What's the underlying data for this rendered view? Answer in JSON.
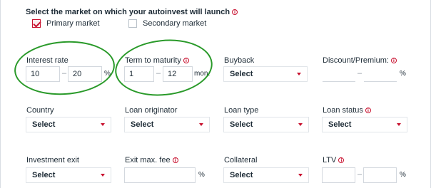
{
  "market": {
    "title": "Select the market on which your autoinvest will launch",
    "primary_label": "Primary market",
    "secondary_label": "Secondary market",
    "primary_checked": true,
    "secondary_checked": false
  },
  "filters": {
    "interest_rate": {
      "label": "Interest rate",
      "min": "10",
      "max": "20",
      "unit": "%"
    },
    "term_to_maturity": {
      "label": "Term to maturity",
      "min": "1",
      "max": "12",
      "unit": "mon."
    },
    "buyback": {
      "label": "Buyback",
      "value": "Select"
    },
    "discount_premium": {
      "label": "Discount/Premium:",
      "min": "",
      "max": "",
      "unit": "%"
    },
    "country": {
      "label": "Country",
      "value": "Select"
    },
    "loan_originator": {
      "label": "Loan originator",
      "value": "Select"
    },
    "loan_type": {
      "label": "Loan type",
      "value": "Select"
    },
    "loan_status": {
      "label": "Loan status",
      "value": "Select"
    },
    "investment_exit": {
      "label": "Investment exit",
      "value": "Select"
    },
    "exit_max_fee": {
      "label": "Exit max. fee",
      "value": "",
      "unit": "%"
    },
    "collateral": {
      "label": "Collateral",
      "value": "Select"
    },
    "ltv": {
      "label": "LTV",
      "min": "",
      "max": "",
      "unit": "%"
    }
  },
  "glyphs": {
    "dash": "–",
    "info": "i"
  },
  "colors": {
    "accent": "#c8102e",
    "annotation": "#2a9a2a"
  }
}
